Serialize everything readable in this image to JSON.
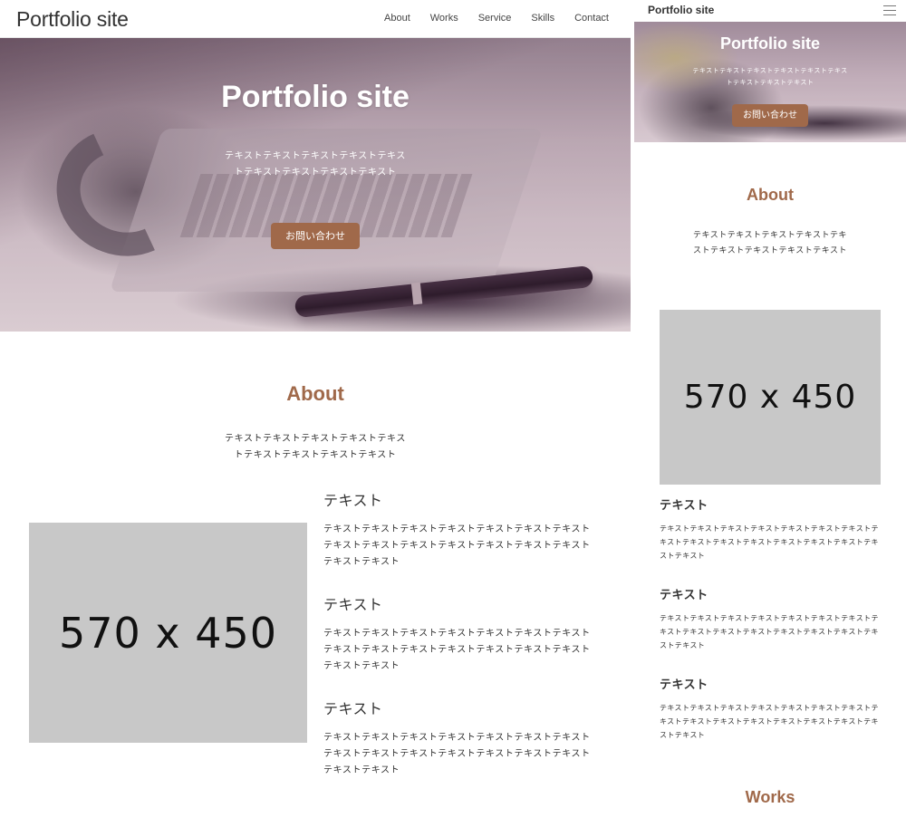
{
  "desktop": {
    "logo": "Portfolio site",
    "nav": [
      "About",
      "Works",
      "Service",
      "Skills",
      "Contact"
    ],
    "hero": {
      "title": "Portfolio site",
      "text": "テキストテキストテキストテキストテキストテキストテキストテキストテキスト",
      "cta": "お問い合わせ"
    },
    "about": {
      "title": "About",
      "text": "テキストテキストテキストテキストテキストテキストテキストテキストテキスト",
      "image_label": "570 x 450",
      "items": [
        {
          "heading": "テキスト",
          "text": "テキストテキストテキストテキストテキストテキストテキストテキストテキストテキストテキストテキストテキストテキストテキストテキスト"
        },
        {
          "heading": "テキスト",
          "text": "テキストテキストテキストテキストテキストテキストテキストテキストテキストテキストテキストテキストテキストテキストテキストテキスト"
        },
        {
          "heading": "テキスト",
          "text": "テキストテキストテキストテキストテキストテキストテキストテキストテキストテキストテキストテキストテキストテキストテキストテキスト"
        }
      ]
    }
  },
  "mobile": {
    "logo": "Portfolio site",
    "menu_icon": "hamburger-icon",
    "hero": {
      "title": "Portfolio site",
      "text": "テキストテキストテキストテキストテキストテキストテキストテキストテキスト",
      "cta": "お問い合わせ"
    },
    "about": {
      "title": "About",
      "text": "テキストテキストテキストテキストテキストテキストテキストテキストテキスト",
      "image_label": "570 x 450",
      "items": [
        {
          "heading": "テキスト",
          "text": "テキストテキストテキストテキストテキストテキストテキストテキストテキストテキストテキストテキストテキストテキストテキストテキスト"
        },
        {
          "heading": "テキスト",
          "text": "テキストテキストテキストテキストテキストテキストテキストテキストテキストテキストテキストテキストテキストテキストテキストテキスト"
        },
        {
          "heading": "テキスト",
          "text": "テキストテキストテキストテキストテキストテキストテキストテキストテキストテキストテキストテキストテキストテキストテキストテキスト"
        }
      ]
    },
    "works_title": "Works"
  },
  "colors": {
    "accent": "#a0694a",
    "placeholder": "#c8c8c8",
    "text": "#333333"
  }
}
